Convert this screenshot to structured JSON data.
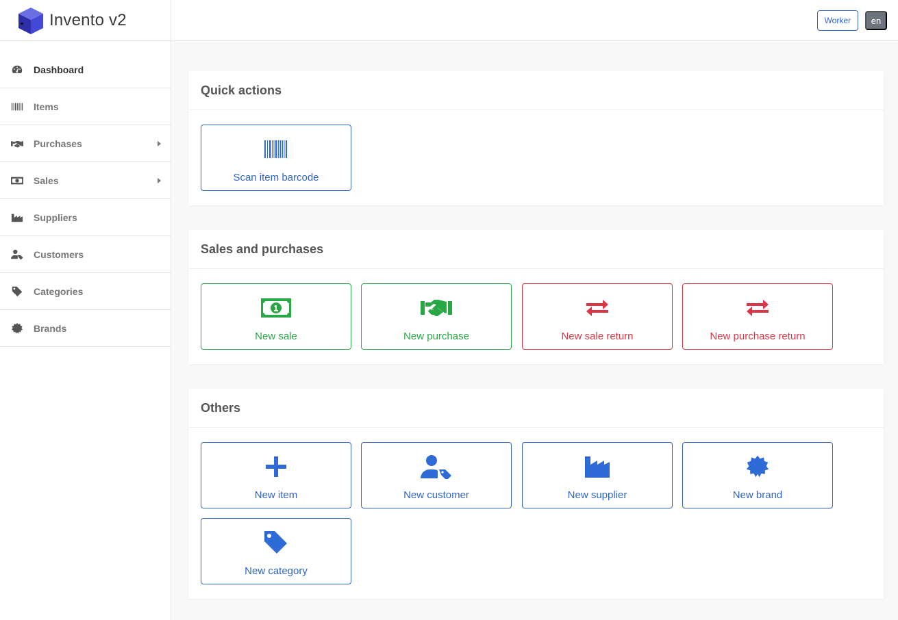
{
  "app": {
    "name": "Invento v2"
  },
  "topbar": {
    "role_label": "Worker",
    "lang_label": "en"
  },
  "sidebar": {
    "items": [
      {
        "label": "Dashboard",
        "icon": "gauge-icon"
      },
      {
        "label": "Items",
        "icon": "barcode-icon"
      },
      {
        "label": "Purchases",
        "icon": "handshake-icon"
      },
      {
        "label": "Sales",
        "icon": "money-bill-icon"
      },
      {
        "label": "Suppliers",
        "icon": "industry-icon"
      },
      {
        "label": "Customers",
        "icon": "user-tag-icon"
      },
      {
        "label": "Categories",
        "icon": "tag-icon"
      },
      {
        "label": "Brands",
        "icon": "certificate-icon"
      }
    ]
  },
  "quick_actions": {
    "title": "Quick actions",
    "tiles": [
      {
        "label": "Scan item barcode",
        "icon": "barcode-icon"
      }
    ]
  },
  "sales_purchases": {
    "title": "Sales and purchases",
    "tiles": [
      {
        "label": "New sale",
        "icon": "money-bill-icon"
      },
      {
        "label": "New purchase",
        "icon": "handshake-icon"
      },
      {
        "label": "New sale return",
        "icon": "exchange-icon"
      },
      {
        "label": "New purchase return",
        "icon": "exchange-icon"
      }
    ]
  },
  "others": {
    "title": "Others",
    "tiles": [
      {
        "label": "New item",
        "icon": "plus-icon"
      },
      {
        "label": "New customer",
        "icon": "user-tag-icon"
      },
      {
        "label": "New supplier",
        "icon": "industry-icon"
      },
      {
        "label": "New brand",
        "icon": "certificate-icon"
      },
      {
        "label": "New category",
        "icon": "tag-icon"
      }
    ]
  },
  "colors": {
    "primary": "#3064c8",
    "success": "#28a745",
    "danger": "#dc3545",
    "secondary": "#6c757d"
  }
}
